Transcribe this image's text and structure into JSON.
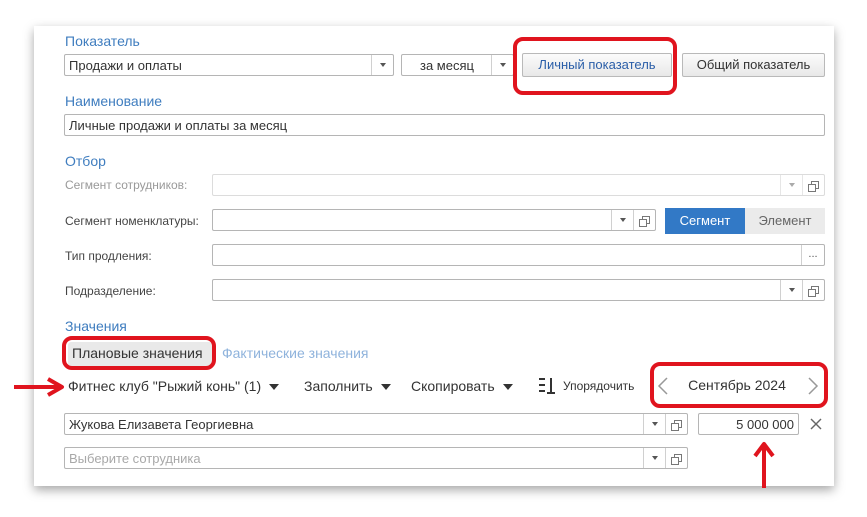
{
  "indicator": {
    "section_title": "Показатель",
    "value": "Продажи и оплаты",
    "period": "за месяц",
    "personal_button": "Личный показатель",
    "common_button": "Общий показатель"
  },
  "name": {
    "section_title": "Наименование",
    "value": "Личные продажи и оплаты за месяц"
  },
  "filter": {
    "section_title": "Отбор",
    "employee_segment_label": "Сегмент сотрудников:",
    "nomenclature_segment_label": "Сегмент номенклатуры:",
    "segment_toggle": "Сегмент",
    "element_toggle": "Элемент",
    "extension_type_label": "Тип продления:",
    "extension_button": "...",
    "department_label": "Подразделение:"
  },
  "values": {
    "section_title": "Значения",
    "tab_planned": "Плановые значения",
    "tab_actual": "Фактические значения",
    "club": "Фитнес клуб \"Рыжий конь\" (1)",
    "fill": "Заполнить",
    "copy": "Скопировать",
    "sort": "Упорядочить",
    "month": "Сентябрь 2024",
    "rows": [
      {
        "employee": "Жукова Елизавета Георгиевна",
        "amount": "5 000 000"
      }
    ],
    "new_employee_placeholder": "Выберите сотрудника"
  },
  "colors": {
    "accent_blue": "#3f7dbf",
    "segment_active": "#3279c6",
    "highlight_red": "#e0141e"
  }
}
